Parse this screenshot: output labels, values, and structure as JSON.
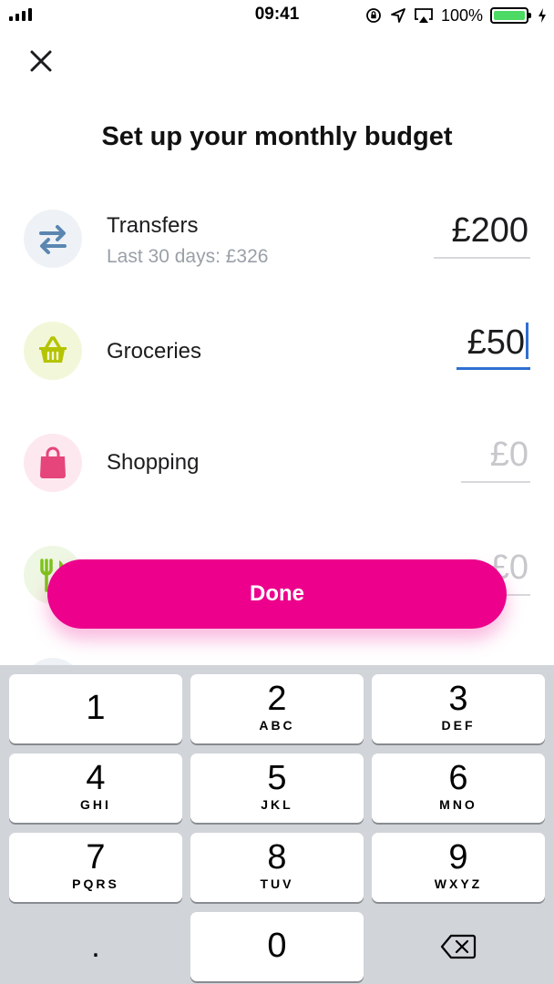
{
  "status_bar": {
    "time": "09:41",
    "battery_percent": "100%",
    "signal_bars": 4
  },
  "header": {
    "title": "Set up your monthly budget"
  },
  "categories": [
    {
      "name": "Transfers",
      "subtitle": "Last 30 days: £326",
      "amount": "£200",
      "icon": "transfer-arrows-icon",
      "icon_color": "#5b86b1",
      "bg_color": "#eef2f6",
      "state": "filled"
    },
    {
      "name": "Groceries",
      "amount": "£50",
      "icon": "basket-icon",
      "icon_color": "#b4c400",
      "bg_color": "#f3f7d9",
      "state": "active"
    },
    {
      "name": "Shopping",
      "amount": "£0",
      "icon": "shopping-bag-icon",
      "icon_color": "#e5457a",
      "bg_color": "#fde8ef",
      "state": "placeholder"
    },
    {
      "name": "",
      "amount": "£0",
      "icon": "fork-knife-icon",
      "icon_color": "#7ec21c",
      "bg_color": "#eef7e3",
      "state": "placeholder"
    }
  ],
  "done_button": {
    "label": "Done",
    "color": "#ec008c"
  },
  "keypad": {
    "keys": [
      {
        "num": "1",
        "letters": ""
      },
      {
        "num": "2",
        "letters": "ABC"
      },
      {
        "num": "3",
        "letters": "DEF"
      },
      {
        "num": "4",
        "letters": "GHI"
      },
      {
        "num": "5",
        "letters": "JKL"
      },
      {
        "num": "6",
        "letters": "MNO"
      },
      {
        "num": "7",
        "letters": "PQRS"
      },
      {
        "num": "8",
        "letters": "TUV"
      },
      {
        "num": "9",
        "letters": "WXYZ"
      },
      {
        "num": "0",
        "letters": ""
      }
    ],
    "decimal": "."
  }
}
